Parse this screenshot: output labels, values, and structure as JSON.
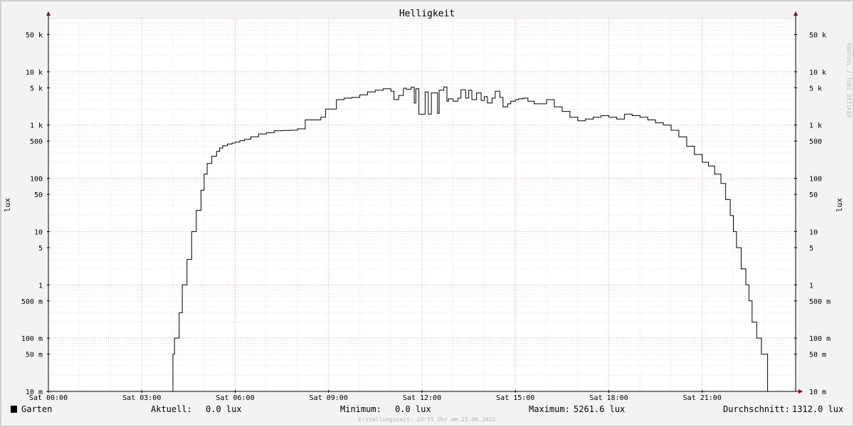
{
  "chart_data": {
    "type": "line",
    "title": "Helligkeit",
    "ylabel": "lux",
    "ylabel_right": "lux",
    "yscale": "log",
    "ylim": [
      0.01,
      100000
    ],
    "xlim": [
      0,
      24
    ],
    "x_ticks": [
      {
        "h": 0,
        "label": "Sat 00:00"
      },
      {
        "h": 3,
        "label": "Sat 03:00"
      },
      {
        "h": 6,
        "label": "Sat 06:00"
      },
      {
        "h": 9,
        "label": "Sat 09:00"
      },
      {
        "h": 12,
        "label": "Sat 12:00"
      },
      {
        "h": 15,
        "label": "Sat 15:00"
      },
      {
        "h": 18,
        "label": "Sat 18:00"
      },
      {
        "h": 21,
        "label": "Sat 21:00"
      }
    ],
    "y_ticks": [
      {
        "v": 0.01,
        "label": "10 m"
      },
      {
        "v": 0.05,
        "label": "50 m"
      },
      {
        "v": 0.1,
        "label": "100 m"
      },
      {
        "v": 0.5,
        "label": "500 m"
      },
      {
        "v": 1,
        "label": "1"
      },
      {
        "v": 5,
        "label": "5"
      },
      {
        "v": 10,
        "label": "10"
      },
      {
        "v": 50,
        "label": "50"
      },
      {
        "v": 100,
        "label": "100"
      },
      {
        "v": 500,
        "label": "500"
      },
      {
        "v": 1000,
        "label": "1 k"
      },
      {
        "v": 5000,
        "label": "5 k"
      },
      {
        "v": 10000,
        "label": "10 k"
      },
      {
        "v": 50000,
        "label": "50 k"
      }
    ],
    "series": [
      {
        "name": "Garten",
        "color": "#000000",
        "x": [
          0,
          4.0,
          4.05,
          4.2,
          4.3,
          4.45,
          4.6,
          4.75,
          4.9,
          5.0,
          5.1,
          5.25,
          5.4,
          5.5,
          5.6,
          5.75,
          5.9,
          6.0,
          6.15,
          6.3,
          6.5,
          6.75,
          7.0,
          7.25,
          7.5,
          7.75,
          8.0,
          8.25,
          8.5,
          8.75,
          8.9,
          9.25,
          9.5,
          9.75,
          10.0,
          10.25,
          10.5,
          10.75,
          11.0,
          11.1,
          11.25,
          11.4,
          11.5,
          11.65,
          11.75,
          11.8,
          11.9,
          12.1,
          12.2,
          12.3,
          12.5,
          12.55,
          12.7,
          12.8,
          12.85,
          13.0,
          13.15,
          13.25,
          13.4,
          13.5,
          13.6,
          13.75,
          13.9,
          14.0,
          14.1,
          14.25,
          14.35,
          14.5,
          14.6,
          14.75,
          14.85,
          15.0,
          15.1,
          15.25,
          15.4,
          15.6,
          16.0,
          16.25,
          16.5,
          16.75,
          17.0,
          17.25,
          17.5,
          17.75,
          18.0,
          18.25,
          18.5,
          18.75,
          19.0,
          19.25,
          19.5,
          19.75,
          20.0,
          20.25,
          20.5,
          20.75,
          21.0,
          21.2,
          21.4,
          21.6,
          21.75,
          21.9,
          22.0,
          22.1,
          22.25,
          22.4,
          22.5,
          22.6,
          22.75,
          22.9,
          23.0,
          23.1,
          23.15,
          23.3,
          23.5,
          23.6,
          24.0
        ],
        "y": [
          0.01,
          0.05,
          0.1,
          0.3,
          1.0,
          3.0,
          10,
          25,
          60,
          120,
          190,
          260,
          320,
          370,
          410,
          440,
          460,
          480,
          510,
          540,
          600,
          680,
          720,
          780,
          790,
          800,
          850,
          1250,
          1250,
          1400,
          2000,
          3000,
          3200,
          3300,
          3700,
          4200,
          4500,
          4800,
          4300,
          3000,
          3600,
          4900,
          4700,
          5100,
          2600,
          4800,
          1600,
          4200,
          1600,
          4000,
          1650,
          4500,
          5200,
          2800,
          3100,
          2800,
          3200,
          4600,
          3200,
          4500,
          3000,
          4000,
          2900,
          3400,
          2600,
          3200,
          4300,
          3300,
          2200,
          2500,
          2800,
          3000,
          3100,
          3200,
          2800,
          2500,
          3000,
          2200,
          1800,
          1400,
          1200,
          1300,
          1400,
          1500,
          1400,
          1300,
          1600,
          1500,
          1400,
          1250,
          1100,
          1000,
          800,
          600,
          400,
          280,
          200,
          170,
          120,
          80,
          40,
          20,
          10,
          5,
          2,
          1,
          0.5,
          0.2,
          0.1,
          0.05,
          0.05,
          0.01,
          0.01,
          0.01,
          0.01,
          0.01,
          0.01
        ]
      }
    ]
  },
  "legend": {
    "series_name": "Garten",
    "swatch_color": "#000000",
    "current_label": "Aktuell:",
    "current_value": "0.0 lux",
    "min_label": "Minimum:",
    "min_value": "0.0 lux",
    "max_label": "Maximum:",
    "max_value": "5261.6 lux",
    "avg_label": "Durchschnitt:",
    "avg_value": "1312.0 lux"
  },
  "footer": "Erstellungszeit: 23:55 Uhr am 25.06.2022",
  "watermark": "RRDTOOL / TOBI OETIKER",
  "colors": {
    "background": "#f3f3f3",
    "plot_background": "#ffffff",
    "major_grid": "#e6b0b0",
    "minor_grid": "#e4e4e4",
    "axis_arrow": "#8b0000"
  }
}
